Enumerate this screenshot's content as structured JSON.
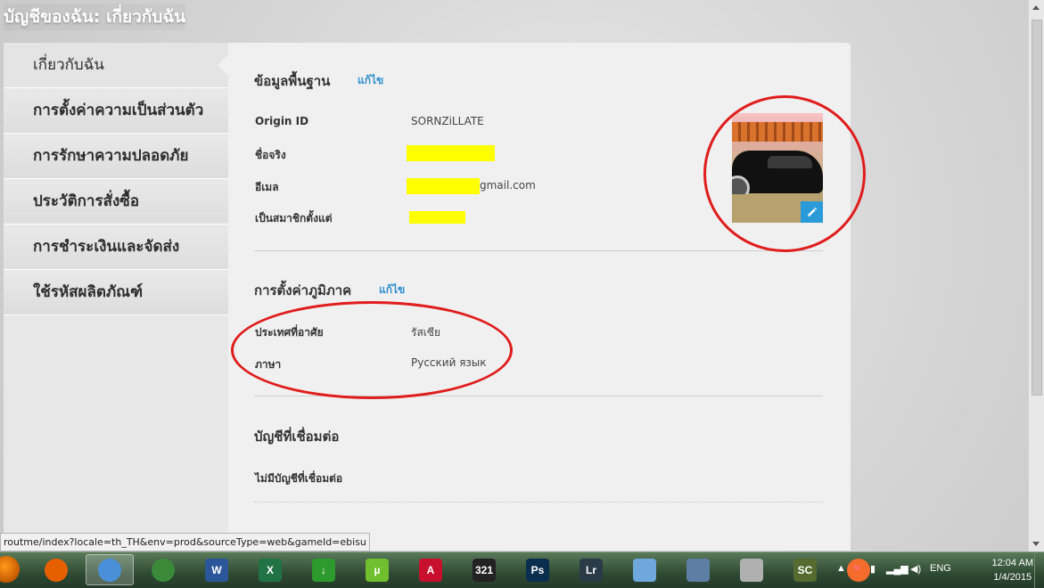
{
  "page": {
    "title": "บัญชีของฉัน: เกี่ยวกับฉัน"
  },
  "sidebar": {
    "items": [
      {
        "label": "เกี่ยวกับฉัน",
        "active": true
      },
      {
        "label": "การตั้งค่าความเป็นส่วนตัว"
      },
      {
        "label": "การรักษาความปลอดภัย"
      },
      {
        "label": "ประวัติการสั่งซื้อ"
      },
      {
        "label": "การชำระเงินและจัดส่ง"
      },
      {
        "label": "ใช้รหัสผลิตภัณฑ์"
      }
    ]
  },
  "basic_info": {
    "heading": "ข้อมูลพื้นฐาน",
    "edit_label": "แก้ไข",
    "origin_id_label": "Origin ID",
    "origin_id_value": "SORNZiLLATE",
    "real_name_label": "ชื่อจริง",
    "email_label": "อีเมล",
    "email_suffix": "gmail.com",
    "member_since_label": "เป็นสมาชิกตั้งแต่"
  },
  "region": {
    "heading": "การตั้งค่าภูมิภาค",
    "edit_label": "แก้ไข",
    "country_label": "ประเทศที่อาศัย",
    "country_value": "รัสเซีย",
    "language_label": "ภาษา",
    "language_value": "Русский язык"
  },
  "linked": {
    "heading": "บัญชีที่เชื่อมต่อ",
    "empty_text": "ไม่มีบัญชีที่เชื่อมต่อ"
  },
  "status_bar": {
    "url": "routme/index?locale=th_TH&env=prod&sourceType=web&gameId=ebisu"
  },
  "taskbar": {
    "apps": [
      {
        "name": "firefox-icon",
        "color": "#e66000",
        "glyph": ""
      },
      {
        "name": "chrome-icon",
        "color": "#4a90d9",
        "glyph": "",
        "active": true
      },
      {
        "name": "globe-icon",
        "color": "#3a8a3a",
        "glyph": ""
      },
      {
        "name": "word-icon",
        "color": "#2b579a",
        "glyph": "W"
      },
      {
        "name": "excel-icon",
        "color": "#217346",
        "glyph": "X"
      },
      {
        "name": "idm-icon",
        "color": "#2d9a2d",
        "glyph": "↓"
      },
      {
        "name": "utorrent-icon",
        "color": "#6fbf2f",
        "glyph": "µ"
      },
      {
        "name": "autocad-icon",
        "color": "#c8102e",
        "glyph": "A"
      },
      {
        "name": "media-player-icon",
        "color": "#222222",
        "glyph": "321"
      },
      {
        "name": "photoshop-icon",
        "color": "#0b2e4f",
        "glyph": "Ps"
      },
      {
        "name": "lightroom-icon",
        "color": "#2b3a47",
        "glyph": "Lr"
      },
      {
        "name": "notepad-icon",
        "color": "#6fa8dc",
        "glyph": ""
      },
      {
        "name": "calculator-icon",
        "color": "#5d7fa3",
        "glyph": ""
      },
      {
        "name": "paint-icon",
        "color": "#b0b0b0",
        "glyph": ""
      },
      {
        "name": "sc-app-icon",
        "color": "#556b2f",
        "glyph": "SC"
      },
      {
        "name": "origin-icon",
        "color": "#f56c2d",
        "glyph": ""
      }
    ],
    "language": "ENG",
    "time": "12:04 AM",
    "date": "1/4/2015"
  }
}
